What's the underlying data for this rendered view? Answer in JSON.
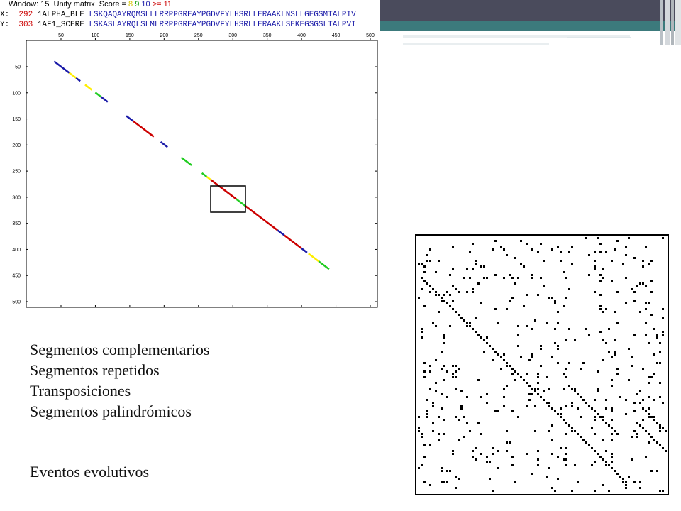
{
  "dotplot": {
    "header": {
      "window_label": "Window: 15  Unity matrix  Score = ",
      "score_8": "8",
      "score_9": "9",
      "score_10": "10",
      "score_ge": ">= 11",
      "x_row": {
        "axis": "X:",
        "pos": "292",
        "name": "1ALPHA_BLE",
        "seq": "LSKQAQAYRQMSLLLRRPPGREAYPGDVFYLHSRLLERAAKLNSLLGEGSMTALPIV"
      },
      "y_row": {
        "axis": "Y:",
        "pos": "303",
        "name": "1AF1_SCERE",
        "seq": "LSKASLAYRQLSLMLRRPPGREAYPGDVFYLHSRLLERAAKLSEKEGSGSLTALPVI"
      }
    },
    "x_ticks": [
      "50",
      "100",
      "150",
      "200",
      "250",
      "300",
      "350",
      "400",
      "450",
      "500"
    ],
    "y_ticks": [
      "50",
      "100",
      "150",
      "200",
      "250",
      "300",
      "350",
      "400",
      "450",
      "500"
    ],
    "colors": {
      "red": "#cc0000",
      "blue": "#1a1aa8",
      "yellow": "#ffee00",
      "green": "#22cc22"
    }
  },
  "text": {
    "line1": "Segmentos complementarios",
    "line2": "Segmentos repetidos",
    "line3": "Transposiciones",
    "line4": "Segmentos palindrómicos",
    "events": "Eventos evolutivos"
  }
}
